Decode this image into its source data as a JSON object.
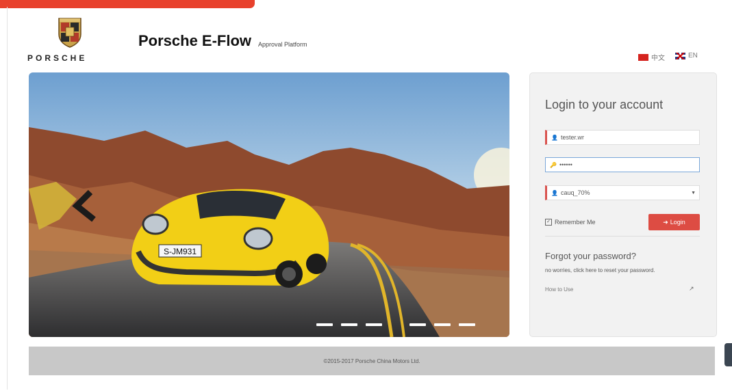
{
  "header": {
    "brand_word": "PORSCHE",
    "title": "Porsche E-Flow",
    "subtitle": "Approval Platform",
    "languages": [
      {
        "label": "中文"
      },
      {
        "label": "EN"
      }
    ]
  },
  "carousel": {
    "plate": "S-JM931",
    "slide_count": 6
  },
  "login": {
    "heading": "Login to your account",
    "username_value": "tester.wr",
    "password_value": "••••••",
    "domain_value": "cauq_70%",
    "remember_label": "Remember Me",
    "login_button": "Login",
    "forgot_title": "Forgot your password?",
    "forgot_text": "no worries, click here to reset your password.",
    "register_text": "How to Use"
  },
  "footer": {
    "copyright": "©2015-2017 Porsche China Motors Ltd."
  },
  "colors": {
    "accent": "#e8412c",
    "button": "#dd4c43",
    "footer_bg": "#c8c8c8"
  }
}
